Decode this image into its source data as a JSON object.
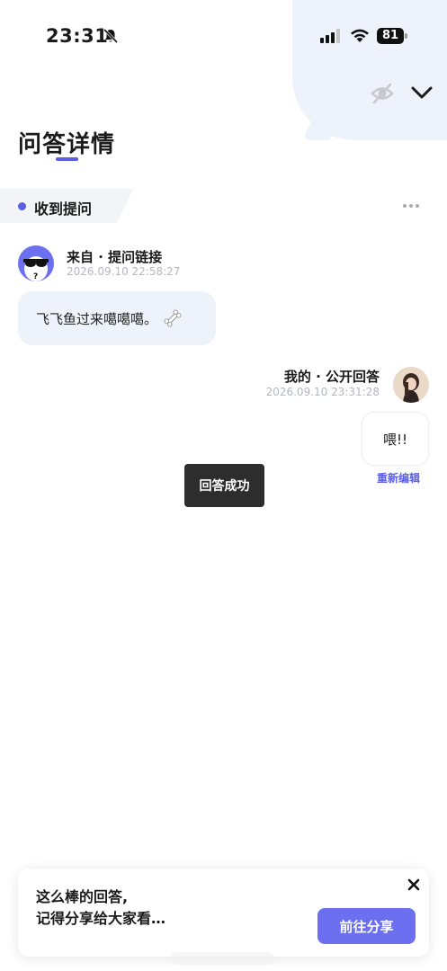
{
  "status_bar": {
    "time": "23:31",
    "battery": "81"
  },
  "header": {
    "title": "问答详情"
  },
  "section": {
    "label": "收到提问"
  },
  "question": {
    "from_label": "来自 · 提问链接",
    "time": "2026.09.10 22:58:27",
    "text": "飞飞鱼过来噶噶噶。"
  },
  "answer": {
    "label": "我的 · 公开回答",
    "time": "2026.09.10 23:31:28",
    "text": "喂!!",
    "reedit_label": "重新编辑"
  },
  "toast": {
    "text": "回答成功"
  },
  "share_card": {
    "line1": "这么棒的回答,",
    "line2": "记得分享给大家看…",
    "button_label": "前往分享"
  },
  "colors": {
    "accent": "#6b6ff0",
    "bubble_bg": "#eef3fb",
    "toast_bg": "#2d2d2d"
  }
}
